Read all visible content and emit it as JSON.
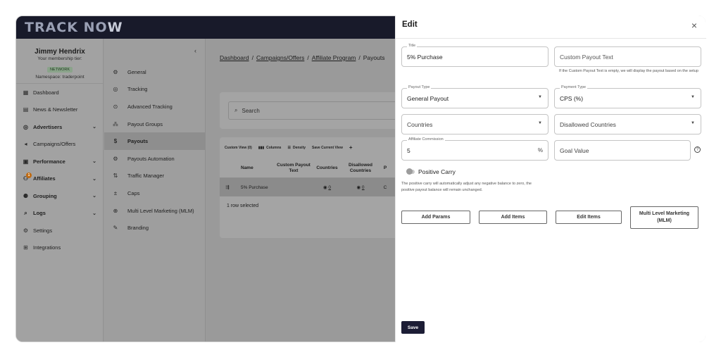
{
  "app": {
    "logo_main": "TRACK NO",
    "logo_accent": "W"
  },
  "user": {
    "name": "Jimmy Hendrix",
    "tier_label": "Your membership tier:",
    "tier": "NETWORK",
    "namespace": "Namespace: traderpoint"
  },
  "sidebar": {
    "items": [
      {
        "label": "Dashboard",
        "icon": "dashboard-icon"
      },
      {
        "label": "News & Newsletter",
        "icon": "newsletter-icon"
      },
      {
        "label": "Advertisers",
        "icon": "advertisers-icon"
      },
      {
        "label": "Campaigns/Offers",
        "icon": "campaigns-icon"
      },
      {
        "label": "Performance",
        "icon": "performance-icon"
      },
      {
        "label": "Affiliates",
        "icon": "affiliates-icon",
        "badge": "1"
      },
      {
        "label": "Grouping",
        "icon": "grouping-icon"
      },
      {
        "label": "Logs",
        "icon": "logs-icon"
      },
      {
        "label": "Settings",
        "icon": "settings-icon"
      },
      {
        "label": "Integrations",
        "icon": "integrations-icon"
      }
    ]
  },
  "subnav": {
    "collapse": "‹",
    "items": [
      {
        "label": "General"
      },
      {
        "label": "Tracking"
      },
      {
        "label": "Advanced Tracking"
      },
      {
        "label": "Payout Groups"
      },
      {
        "label": "Payouts",
        "active": true
      },
      {
        "label": "Payouts Automation"
      },
      {
        "label": "Traffic Manager"
      },
      {
        "label": "Caps"
      },
      {
        "label": "Multi Level Marketing (MLM)"
      },
      {
        "label": "Branding"
      }
    ]
  },
  "breadcrumb": {
    "c1": "Dashboard",
    "c2": "Campaigns/Offers",
    "c3": "Affiliate Program",
    "c4": "Payouts"
  },
  "search": {
    "placeholder": "Search"
  },
  "table": {
    "toolbar": {
      "custom_view": "Custom View (0)",
      "columns": "Columns",
      "density": "Density",
      "save_view": "Save Current View",
      "add": "+"
    },
    "headers": {
      "name": "Name",
      "custom_payout": "Custom Payout Text",
      "countries": "Countries",
      "disallowed": "Disallowed Countries",
      "more": "P"
    },
    "row": {
      "name": "5% Purchase",
      "countries": "0",
      "disallowed": "0",
      "more": "C"
    },
    "footer": "1 row selected"
  },
  "edit": {
    "title": "Edit",
    "close": "×",
    "title_field": {
      "label": "Title",
      "value": "5% Purchase"
    },
    "custom_payout_text": {
      "placeholder": "Custom Payout Text",
      "helper": "If the Custom Payout Text is empty, we will display the payout based on the setup"
    },
    "payout_type": {
      "label": "Payout Type",
      "value": "General Payout"
    },
    "payment_type": {
      "label": "Payment Type",
      "value": "CPS (%)"
    },
    "countries": {
      "placeholder": "Countries"
    },
    "disallowed_countries": {
      "placeholder": "Disallowed Countries"
    },
    "affiliate_commission": {
      "label": "Affiliate Commission",
      "value": "5",
      "unit": "%"
    },
    "goal_value": {
      "placeholder": "Goal Value"
    },
    "positive_carry": {
      "label": "Positive Carry",
      "enabled": false,
      "helper": "The positive carry will automatically adjust any negative balance to zero, the positive payout balance will remain unchanged."
    },
    "buttons": {
      "add_params": "Add Params",
      "add_items": "Add Items",
      "edit_items": "Edit Items",
      "mlm": "Multi Level Marketing (MLM)"
    },
    "save": "Save"
  }
}
